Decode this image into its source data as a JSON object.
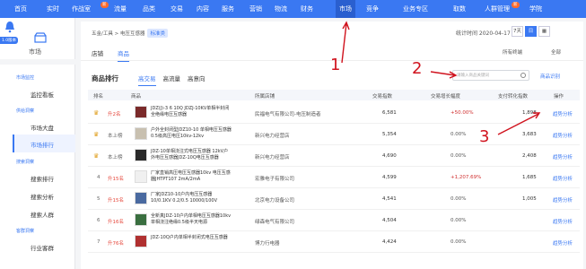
{
  "nav": [
    {
      "label": "首页"
    },
    {
      "label": "实时"
    },
    {
      "label": "作战室",
      "badge": "新"
    },
    {
      "label": "流量"
    },
    {
      "label": "品类"
    },
    {
      "label": "交易"
    },
    {
      "label": "内容"
    },
    {
      "label": "服务"
    },
    {
      "label": "营销"
    },
    {
      "label": "物流"
    },
    {
      "label": "财务"
    },
    {
      "label": "市场",
      "active": true
    },
    {
      "label": "竞争"
    },
    {
      "label": "业务专区"
    },
    {
      "label": "取数"
    },
    {
      "label": "人群管理",
      "badge": "新"
    },
    {
      "label": "学院"
    }
  ],
  "sidebar": {
    "section_label": "市场",
    "tag": "1.0版本",
    "groups": [
      {
        "label": "市场监控",
        "items": [
          "监控看板"
        ]
      },
      {
        "label": "供给洞察",
        "items": [
          "市场大盘",
          "市场排行"
        ]
      },
      {
        "label": "搜索洞察",
        "items": [
          "搜索排行",
          "搜索分析",
          "搜索人群"
        ]
      },
      {
        "label": "客群洞察",
        "items": [
          "行业客群"
        ]
      }
    ]
  },
  "breadcrumb": {
    "text": "五金/工具 > 电压互感器",
    "chip": "标准类"
  },
  "date": {
    "label": "统计时间 2020-04-17",
    "buttons": [
      "7天",
      "日"
    ]
  },
  "tabs_top": [
    "店铺",
    "商品"
  ],
  "right_selects": [
    "所有终端",
    "全部"
  ],
  "rank": {
    "title": "商品排行",
    "tabs": [
      "高交易",
      "高流量",
      "高意向"
    ],
    "search_placeholder": "请输入商品关键词",
    "export": "商品识别"
  },
  "columns": [
    "排名",
    "商品",
    "所属店铺",
    "交易指数",
    "交易增长幅度",
    "支付转化指数",
    "操作"
  ],
  "rows": [
    {
      "rank": "1",
      "change": "升2名",
      "name": "JDZ(J)-3 6 10Q JDZJ-10KV单相半封闭全绝缘电压互感器",
      "shop": "民福电气有限公司-电压制造者",
      "trade": "6,581",
      "growth": "+50.00%",
      "conv": "1,898",
      "action": "趋势分析"
    },
    {
      "rank": "2",
      "change": "本上榜",
      "name": "户外全封闭型JDZ10-10 单相电压互感器0.5级高压电压10kv-12kv",
      "shop": "新兴电力经营店",
      "trade": "5,354",
      "growth": "0.00%",
      "conv": "3,683",
      "action": "趋势分析"
    },
    {
      "rank": "3",
      "change": "本上榜",
      "name": "JDZ-10单相浇注式电压互感器 12kV户外电压互感器JDZ-10Q电压互感器",
      "shop": "新兴电力经营店",
      "trade": "4,690",
      "growth": "0.00%",
      "conv": "2,408",
      "action": "趋势分析"
    },
    {
      "rank": "4",
      "change": "升15名",
      "name": "厂家直销高压电压互感器10kv 电压互感器JHTPT107 2mA/2mA",
      "shop": "宏雅电子有限公司",
      "trade": "4,599",
      "growth": "+1,207.69%",
      "conv": "1,685",
      "action": "趋势分析"
    },
    {
      "rank": "5",
      "change": "升15名",
      "name": "厂家JDZ10-10户内电压互感器 10/0.1KV 0.2/0.5 10000/100V",
      "shop": "北京电力设备公司",
      "trade": "4,541",
      "growth": "0.00%",
      "conv": "1,005",
      "action": "趋势分析"
    },
    {
      "rank": "6",
      "change": "升16名",
      "name": "全新真JDZ-10户内单相电压互感器10kv单相浇注绝缘0.5级半天电源",
      "shop": "绿森电气有限公司",
      "trade": "4,504",
      "growth": "0.00%",
      "conv": "",
      "action": "趋势分析"
    },
    {
      "rank": "7",
      "change": "升76名",
      "name": "JDZ-10Q户内单相半封闭式电压互感器",
      "shop": "博力行电器",
      "trade": "4,424",
      "growth": "0.00%",
      "conv": "",
      "action": "趋势分析"
    }
  ],
  "annotations": [
    "1",
    "2",
    "3"
  ],
  "colors": {
    "accent": "#3a78f2",
    "up": "#e6483c",
    "down_pct": "#d03030",
    "annotation": "#d0131e"
  }
}
